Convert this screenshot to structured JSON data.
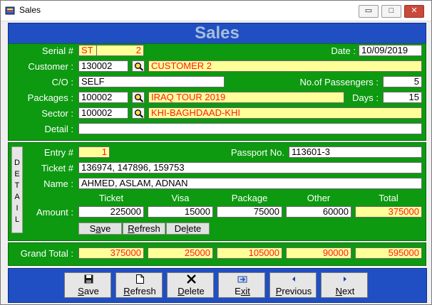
{
  "window": {
    "title": "Sales",
    "minimize": "▭",
    "maximize": "□",
    "close": "✕"
  },
  "header": {
    "title": "Sales"
  },
  "master": {
    "serial_label": "Serial #",
    "serial_prefix": "ST",
    "serial_number": "2",
    "date_label": "Date :",
    "date_value": "10/09/2019",
    "customer_label": "Customer :",
    "customer_code": "130002",
    "customer_name": "CUSTOMER 2",
    "co_label": "C/O :",
    "co_value": "SELF",
    "passengers_label": "No.of Passengers :",
    "passengers_value": "5",
    "packages_label": "Packages :",
    "package_code": "100002",
    "package_name": "IRAQ TOUR 2019",
    "days_label": "Days :",
    "days_value": "15",
    "sector_label": "Sector :",
    "sector_code": "100002",
    "sector_name": "KHI-BAGHDAAD-KHI",
    "detail_label": "Detail :",
    "detail_value": ""
  },
  "detail": {
    "tab_letters": [
      "D",
      "E",
      "T",
      "A",
      "I",
      "L"
    ],
    "entry_label": "Entry #",
    "entry_value": "1",
    "passport_label": "Passport No.",
    "passport_value": "113601-3",
    "ticket_label": "Ticket #",
    "ticket_value": "136974, 147896, 159753",
    "name_label": "Name :",
    "name_value": "AHMED, ASLAM, ADNAN",
    "columns": [
      "Ticket",
      "Visa",
      "Package",
      "Other",
      "Total"
    ],
    "amount_label": "Amount :",
    "amounts": [
      "225000",
      "15000",
      "75000",
      "60000",
      "375000"
    ],
    "save_pre": "S",
    "save_u": "a",
    "save_post": "ve",
    "refresh_pre": "",
    "refresh_u": "R",
    "refresh_post": "efresh",
    "delete_pre": "De",
    "delete_u": "l",
    "delete_post": "ete"
  },
  "totals": {
    "label": "Grand Total :",
    "values": [
      "375000",
      "25000",
      "105000",
      "90000",
      "595000"
    ]
  },
  "toolbar": {
    "save": {
      "u": "S",
      "rest": "ave",
      "icon": "floppy-icon"
    },
    "refresh": {
      "u": "R",
      "rest": "efresh",
      "icon": "document-icon"
    },
    "delete": {
      "u": "D",
      "rest": "elete",
      "icon": "x-icon"
    },
    "exit": {
      "u": "E",
      "rest": "xit",
      "icon": "exit-icon"
    },
    "previous": {
      "u": "P",
      "rest": "revious",
      "icon": "arrow-left-icon"
    },
    "next": {
      "u": "N",
      "rest": "ext",
      "icon": "arrow-right-icon"
    }
  },
  "colors": {
    "panel_green": "#0d9a10",
    "band_blue": "#1f4fc3",
    "field_yellow": "#ffff99",
    "value_red": "#ff1a1a"
  }
}
